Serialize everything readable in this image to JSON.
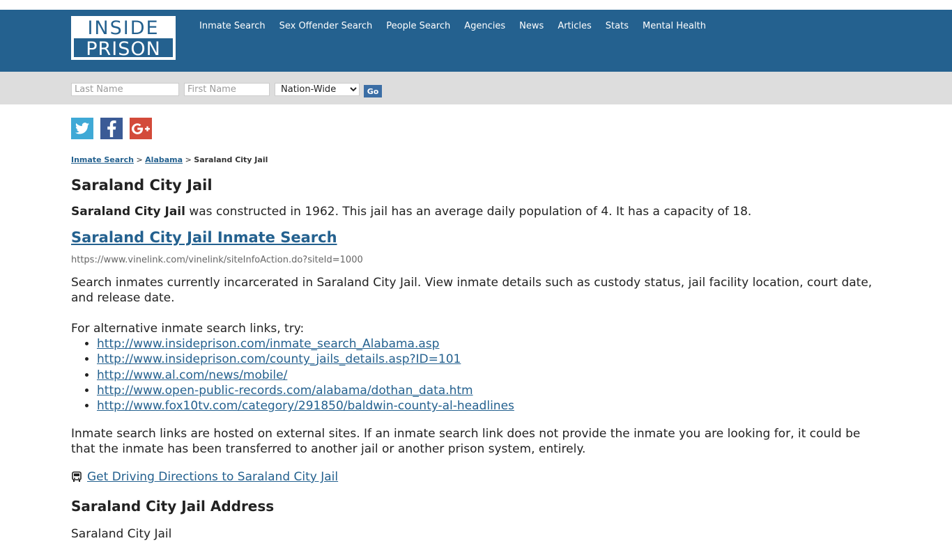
{
  "logo": {
    "line1": "INSIDE",
    "line2": "PRISON"
  },
  "nav": [
    "Inmate Search",
    "Sex Offender Search",
    "People Search",
    "Agencies",
    "News",
    "Articles",
    "Stats",
    "Mental Health"
  ],
  "search": {
    "last_name_placeholder": "Last Name",
    "first_name_placeholder": "First Name",
    "scope_selected": "Nation-Wide",
    "go_label": "Go"
  },
  "social": {
    "twitter": "twitter-icon",
    "facebook": "facebook-icon",
    "google_plus": "google-plus-icon"
  },
  "breadcrumb": {
    "item1": "Inmate Search",
    "sep1": ">",
    "item2": "Alabama",
    "sep2": ">",
    "current": "Saraland City Jail"
  },
  "page": {
    "title": "Saraland City Jail",
    "intro_bold": "Saraland City Jail",
    "intro_rest": " was constructed in 1962. This jail has an average daily population of 4. It has a capacity of 18.",
    "search_link": "Saraland City Jail Inmate Search",
    "search_url": "https://www.vinelink.com/vinelink/siteInfoAction.do?siteId=1000",
    "desc": "Search inmates currently incarcerated in Saraland City Jail. View inmate details such as custody status, jail facility location, court date, and release date.",
    "alt_intro": "For alternative inmate search links, try:",
    "alt_links": [
      "http://www.insideprison.com/inmate_search_Alabama.asp",
      "http://www.insideprison.com/county_jails_details.asp?ID=101",
      "http://www.al.com/news/mobile/",
      "http://www.open-public-records.com/alabama/dothan_data.htm",
      "http://www.fox10tv.com/category/291850/baldwin-county-al-headlines"
    ],
    "disclaimer": "Inmate search links are hosted on external sites. If an inmate search link does not provide the inmate you are looking for, it could be that the inmate has been transferred to another jail or another prison system, entirely.",
    "directions": "Get Driving Directions to Saraland City Jail",
    "address_heading": "Saraland City Jail Address",
    "address_name": "Saraland City Jail"
  },
  "colors": {
    "header": "#24618f",
    "searchbar": "#dddddd",
    "link": "#24618f",
    "go_button": "#3b6ea5"
  }
}
